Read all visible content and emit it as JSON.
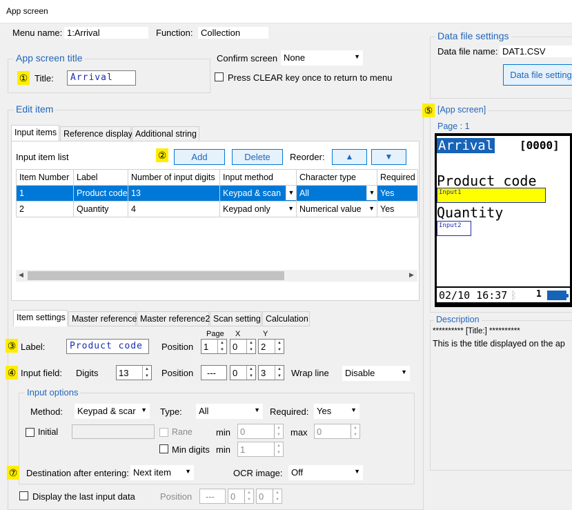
{
  "window": {
    "title": "App screen"
  },
  "menu": {
    "name_label": "Menu name:",
    "name_value": "1:Arrival",
    "function_label": "Function:",
    "function_value": "Collection"
  },
  "app_title": {
    "group_title": "App screen title",
    "marker": "①",
    "label": "Title:",
    "value": "Arrival"
  },
  "confirm": {
    "label": "Confirm screen",
    "value": "None",
    "press_clear_label": "Press CLEAR key once to return to menu"
  },
  "data_file": {
    "group_title": "Data file settings",
    "name_label": "Data file name:",
    "name_value": "DAT1.CSV",
    "button": "Data file setting"
  },
  "edit_item": {
    "group_title": "Edit item",
    "tabs": [
      "Input items",
      "Reference display",
      "Additional string"
    ],
    "list_label": "Input item list",
    "marker": "②",
    "add_button": "Add",
    "delete_button": "Delete",
    "reorder_label": "Reorder:",
    "up_icon": "▲",
    "down_icon": "▼",
    "columns": [
      "Item Number",
      "Label",
      "Number of input digits",
      "Input method",
      "Character type",
      "Required i"
    ],
    "rows": [
      [
        "1",
        "Product code",
        "13",
        "Keypad & scan",
        "All",
        "Yes"
      ],
      [
        "2",
        "Quantity",
        "4",
        "Keypad only",
        "Numerical value",
        "Yes"
      ]
    ]
  },
  "item_settings": {
    "tabs": [
      "Item settings",
      "Master reference",
      "Master reference2",
      "Scan setting",
      "Calculation"
    ],
    "label_marker": "③",
    "label_label": "Label:",
    "label_value": "Product code",
    "position_label": "Position",
    "page_header": "Page",
    "x_header": "X",
    "y_header": "Y",
    "label_page": "1",
    "label_x": "0",
    "label_y": "2",
    "input_marker": "④",
    "input_field_label": "Input field:",
    "digits_label": "Digits",
    "digits_value": "13",
    "input_page": "---",
    "input_x": "0",
    "input_y": "3",
    "wrap_label": "Wrap line",
    "wrap_value": "Disable",
    "options_title": "Input options",
    "method_label": "Method:",
    "method_value": "Keypad & scar",
    "type_label": "Type:",
    "type_value": "All",
    "required_label": "Required:",
    "required_value": "Yes",
    "initial_label": "Initial",
    "range_label": "Rane",
    "min_label": "min",
    "min_value": "0",
    "max_label": "max",
    "max_value": "0",
    "min_digits_label": "Min digits",
    "min_digits_min_label": "min",
    "min_digits_value": "1",
    "dest_marker": "⑦",
    "dest_label": "Destination after entering:",
    "dest_value": "Next item",
    "ocr_label": "OCR image:",
    "ocr_value": "Off",
    "display_last_label": "Display the last input data",
    "display_last_position_label": "Position",
    "display_last_page": "---",
    "display_last_x": "0",
    "display_last_y": "0"
  },
  "preview": {
    "marker": "⑤",
    "title": "[App screen]",
    "page": "Page : 1",
    "screen_title": "Arrival",
    "counter": "[0000]",
    "field1_label": "Product code",
    "field1_input": "Input1",
    "field2_label": "Quantity",
    "field2_input": "Input2",
    "datetime": "02/10 16:37",
    "status_num": "1",
    "bluetooth_icon": "ᛒ",
    "battery_icon": "battery-icon"
  },
  "description": {
    "title": "Description",
    "line1": "**********  [Title:]  **********",
    "line2": "This is the title displayed on the ap"
  }
}
